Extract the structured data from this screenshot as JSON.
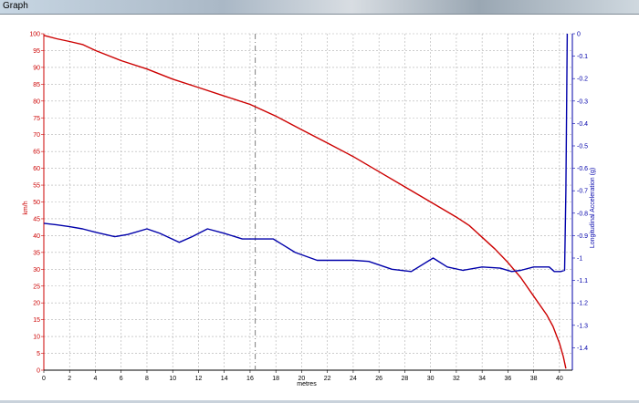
{
  "window": {
    "title": "Graph"
  },
  "colors": {
    "speed_series": "#cc0000",
    "accel_series": "#0000aa",
    "left_axis": "#cc0000",
    "right_axis": "#0000aa",
    "grid": "#b0b0b0",
    "cursor_line": "#808080"
  },
  "chart_data": {
    "type": "line",
    "xlabel": "metres",
    "ylabel_left": "km/h",
    "ylabel_right": "Longitudinal Acceleration (g)",
    "xlim": [
      0,
      41
    ],
    "ylim_left": [
      0,
      100
    ],
    "ylim_right": [
      -1.5,
      0
    ],
    "grid": true,
    "x_ticks": [
      0,
      2,
      4,
      6,
      8,
      10,
      12,
      14,
      16,
      18,
      20,
      22,
      24,
      26,
      28,
      30,
      32,
      34,
      36,
      38,
      40
    ],
    "y_ticks_left": [
      0,
      5,
      10,
      15,
      20,
      25,
      30,
      35,
      40,
      45,
      50,
      55,
      60,
      65,
      70,
      75,
      80,
      85,
      90,
      95,
      100
    ],
    "y_ticks_right": [
      "0",
      "-0.1",
      "-0.2",
      "-0.3",
      "-0.4",
      "-0.5",
      "-0.6",
      "-0.7",
      "-0.8",
      "-0.9",
      "-1",
      "-1.1",
      "-1.2",
      "-1.3",
      "-1.4"
    ],
    "y_ticks_right_values": [
      0,
      -0.1,
      -0.2,
      -0.3,
      -0.4,
      -0.5,
      -0.6,
      -0.7,
      -0.8,
      -0.9,
      -1,
      -1.1,
      -1.2,
      -1.3,
      -1.4
    ],
    "cursor_x": 16.4,
    "series": [
      {
        "axis": "left",
        "x": [
          0,
          1,
          2,
          3,
          4,
          6,
          8,
          10,
          12,
          14,
          16,
          18,
          20,
          22,
          24,
          26,
          28,
          30,
          32,
          33,
          34,
          35,
          36,
          37,
          38,
          39,
          39.5,
          40,
          40.3,
          40.5
        ],
        "values": [
          99.5,
          98.5,
          97.7,
          96.8,
          95,
          92,
          89.5,
          86.5,
          84,
          81.5,
          79,
          75.5,
          71.5,
          67.5,
          63.5,
          59,
          54.5,
          50,
          45.5,
          43,
          39.5,
          36,
          32,
          27.5,
          22,
          16.5,
          13,
          8,
          4,
          0.5
        ]
      },
      {
        "axis": "right",
        "x": [
          0,
          1,
          2,
          3,
          4,
          5.5,
          6.5,
          8,
          9,
          10.5,
          11.5,
          12.7,
          14,
          15.4,
          17,
          17.8,
          18.5,
          19.5,
          21.2,
          23,
          24,
          25.2,
          27,
          28.5,
          30.2,
          31.3,
          32.5,
          34,
          35.4,
          36.3,
          37,
          38,
          39.2,
          39.6,
          40.1,
          40.4,
          40.5,
          40.6
        ],
        "values": [
          -0.845,
          -0.852,
          -0.86,
          -0.87,
          -0.885,
          -0.905,
          -0.895,
          -0.87,
          -0.89,
          -0.93,
          -0.905,
          -0.87,
          -0.89,
          -0.915,
          -0.915,
          -0.915,
          -0.94,
          -0.975,
          -1.01,
          -1.01,
          -1.01,
          -1.015,
          -1.05,
          -1.06,
          -1.0,
          -1.04,
          -1.055,
          -1.04,
          -1.045,
          -1.06,
          -1.055,
          -1.04,
          -1.04,
          -1.06,
          -1.06,
          -1.055,
          -0.7,
          -0.0
        ]
      }
    ]
  }
}
